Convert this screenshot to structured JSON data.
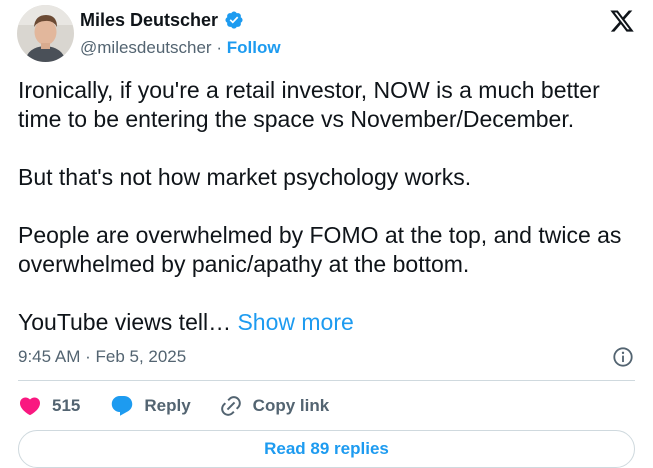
{
  "author": {
    "name": "Miles Deutscher",
    "handle": "@milesdeutscher",
    "separator": "·",
    "follow_label": "Follow",
    "verified_icon": "verified-badge-icon",
    "avatar_icon": "avatar"
  },
  "platform_icon": "x-logo-icon",
  "post": {
    "paragraphs": [
      "Ironically, if you're a retail investor, NOW is a much better time to be entering the space vs November/December.",
      "But that's not how market psychology works.",
      "People are overwhelmed by FOMO at the top, and twice as overwhelmed by panic/apathy at the bottom."
    ],
    "truncated_text": "YouTube views tell… ",
    "show_more_label": "Show more"
  },
  "meta": {
    "timestamp": "9:45 AM · Feb 5, 2025",
    "info_icon": "info-icon"
  },
  "actions": {
    "like_count": "515",
    "reply_label": "Reply",
    "copy_link_label": "Copy link"
  },
  "read_replies_label": "Read 89 replies",
  "colors": {
    "accent": "#1d9bf0",
    "like": "#f91880",
    "secondary_text": "#536471",
    "divider": "#cfd9de"
  }
}
